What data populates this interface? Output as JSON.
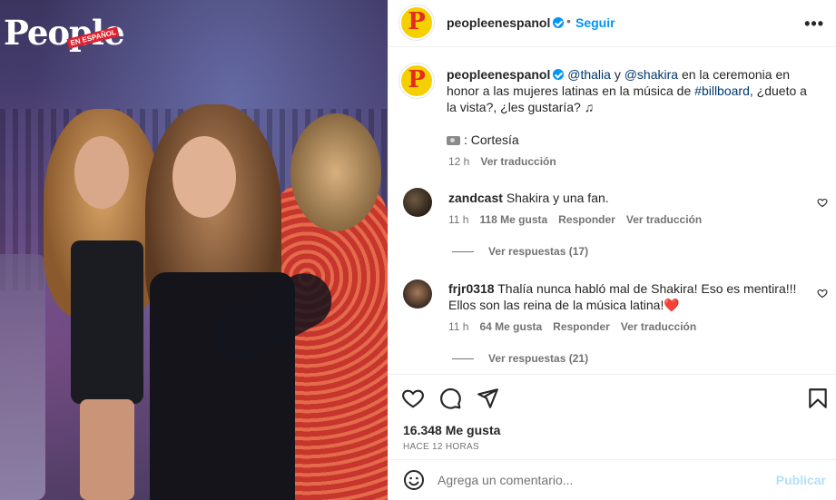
{
  "media": {
    "logo_text": "People",
    "logo_tag": "EN ESPAÑOL"
  },
  "header": {
    "username": "peopleenespanol",
    "dot": "•",
    "follow_label": "Seguir",
    "more_label": "•••",
    "avatar_letter": "P"
  },
  "caption": {
    "username": "peopleenespanol",
    "mention1": "@thalia",
    "conj": " y ",
    "mention2": "@shakira",
    "text1": " en la ceremonia en honor a las mujeres latinas en la música de ",
    "hashtag": "#billboard",
    "text2": ", ¿dueto a la vista?, ¿les gustaría? ♫",
    "credit": ": Cortesía",
    "time": "12 h",
    "translate": "Ver traducción"
  },
  "comments": [
    {
      "username": "zandcast",
      "text": "Shakira y una fan.",
      "time": "11 h",
      "likes": "118 Me gusta",
      "reply": "Responder",
      "translate": "Ver traducción",
      "replies": "Ver respuestas (17)"
    },
    {
      "username": "frjr0318",
      "text": "Thalía nunca habló mal de Shakira! Eso es mentira!!! Ellos son las reina de la música latina!❤️",
      "time": "11 h",
      "likes": "64 Me gusta",
      "reply": "Responder",
      "translate": "Ver traducción",
      "replies": "Ver respuestas (21)"
    }
  ],
  "footer": {
    "likes": "16.348 Me gusta",
    "time_ago": "HACE 12 HORAS",
    "comment_placeholder": "Agrega un comentario...",
    "publish_label": "Publicar"
  },
  "colors": {
    "accent": "#0095f6",
    "link": "#00376b",
    "muted": "#737373",
    "publish_disabled": "#b2dffc"
  },
  "icons": {
    "like": "heart-icon",
    "comment": "comment-icon",
    "share": "share-icon",
    "save": "bookmark-icon",
    "emoji": "smile-icon",
    "more": "more-icon",
    "verified": "verified-icon",
    "camera": "camera-icon"
  }
}
